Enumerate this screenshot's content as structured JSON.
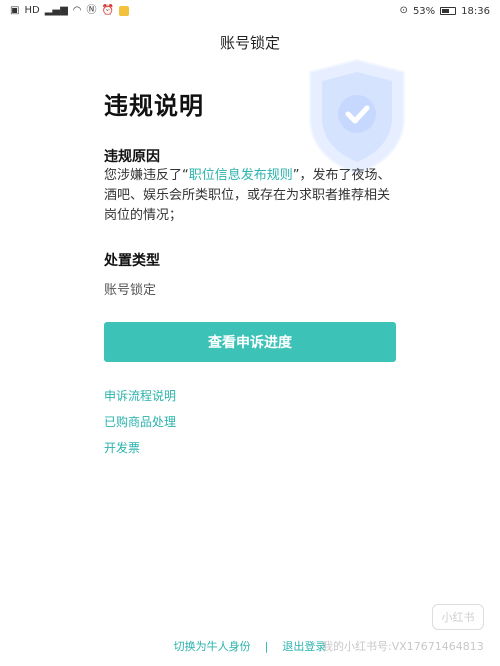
{
  "status_bar": {
    "left_icons": [
      "notification-icon",
      "signal-icon",
      "wifi-icon",
      "n-icon",
      "alarm-icon",
      "app-icon"
    ],
    "hd_label": "HD",
    "battery_percent": "53%",
    "time": "18:36"
  },
  "header": {
    "title": "账号锁定"
  },
  "main": {
    "heading": "违规说明",
    "reason_label": "违规原因",
    "reason_text_before": "您涉嫌违反了“",
    "rule_link": "职位信息发布规则",
    "reason_text_after": "”，发布了夜场、酒吧、娱乐会所类职位，或存在为求职者推荐相关岗位的情况；",
    "type_label": "处置类型",
    "type_value": "账号锁定",
    "primary_button": "查看申诉进度"
  },
  "links": [
    "申诉流程说明",
    "已购商品处理",
    "开发票"
  ],
  "bottom": {
    "switch_identity": "切换为牛人身份",
    "separator": "|",
    "logout": "退出登录"
  },
  "watermark": {
    "badge": "小红书",
    "text": "我的小红书号:VX17671464813"
  },
  "colors": {
    "accent": "#3cc2b6",
    "link": "#2bb3ad",
    "shield": "#dfe9ff"
  }
}
